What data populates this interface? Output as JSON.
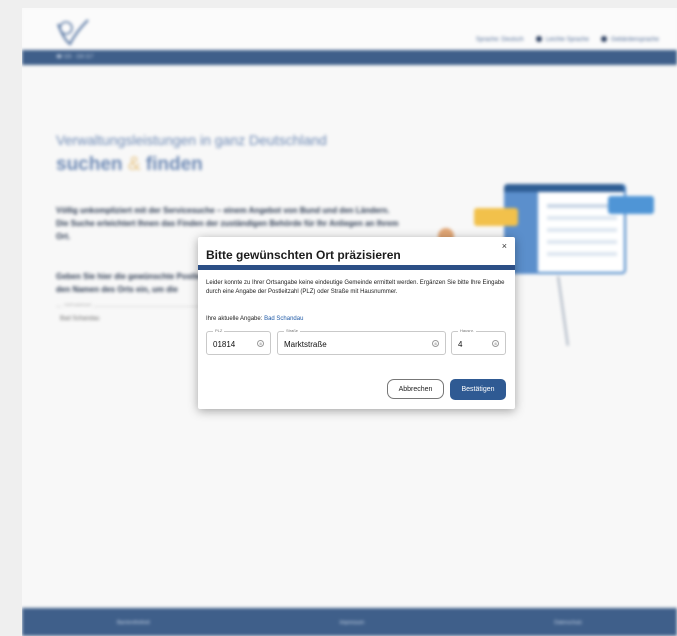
{
  "header": {
    "language_link": "Sprache: Deutsch",
    "simple_language_link": "Leichte Sprache",
    "sign_language_link": "Gebärdensprache",
    "phone": "☎ 115 · 116 117"
  },
  "hero": {
    "line1": "Verwaltungsleistungen in ganz Deutschland",
    "line2_a": "suchen",
    "line2_amp": "&",
    "line2_b": "finden",
    "intro": "Völlig unkompliziert mit der Servicesuche – einem Angebot von Bund und den Ländern. Die Suche erleichtert Ihnen das Finden der zuständigen Behörde für Ihr Anliegen an Ihrem Ort.",
    "prompt": "Geben Sie hier die gewünschte Postleitzahl oder den Namen des Orts ein, um die",
    "input_label": "Ort/Postleitzahl",
    "input_value": "Bad Schandau"
  },
  "footer": {
    "links": [
      "Barrierefreiheit",
      "Impressum",
      "Datenschutz"
    ]
  },
  "modal": {
    "title": "Bitte gewünschten Ort präzisieren",
    "close_glyph": "×",
    "message": "Leider konnte zu Ihrer Ortsangabe keine eindeutige Gemeinde ermittelt werden. Ergänzen Sie bitte Ihre Eingabe durch eine Angabe der Postleitzahl (PLZ) oder Straße mit Hausnummer.",
    "current_label": "Ihre aktuelle Angabe:",
    "current_value": "Bad Schandau",
    "fields": {
      "plz": {
        "label": "PLZ",
        "value": "01814"
      },
      "street": {
        "label": "Straße",
        "value": "Marktstraße"
      },
      "house": {
        "label": "Hausnr.",
        "value": "4"
      }
    },
    "clear_glyph": "⊗",
    "cancel_label": "Abbrechen",
    "confirm_label": "Bestätigen"
  },
  "colors": {
    "brand_blue": "#3f5f8a",
    "modal_rule": "#2c4f86",
    "confirm_button": "#2f5a93",
    "link": "#1f5aa7"
  }
}
